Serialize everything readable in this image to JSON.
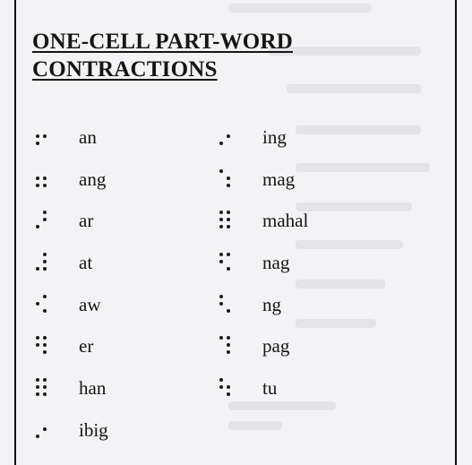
{
  "title": {
    "line1": "ONE-CELL PART-WORD",
    "line2": "CONTRACTIONS"
  },
  "contractions_left": [
    {
      "braille": "⠖",
      "dots": [
        2,
        3,
        5
      ],
      "word": "an"
    },
    {
      "braille": "⠶",
      "dots": [
        2,
        3,
        5,
        6
      ],
      "word": "ang"
    },
    {
      "braille": "⠜",
      "dots": [
        3,
        4,
        5
      ],
      "word": "ar"
    },
    {
      "braille": "⠼",
      "dots": [
        3,
        4,
        5,
        6
      ],
      "word": "at"
    },
    {
      "braille": "⠪",
      "dots": [
        2,
        4,
        6
      ],
      "word": "aw"
    },
    {
      "braille": "⠻",
      "dots": [
        1,
        2,
        4,
        5,
        6
      ],
      "word": "er"
    },
    {
      "braille": "⠿",
      "dots": [
        1,
        2,
        3,
        4,
        5,
        6
      ],
      "word": "han"
    },
    {
      "braille": "⠔",
      "dots": [
        3,
        5
      ],
      "word": "ibig"
    }
  ],
  "contractions_right": [
    {
      "braille": "⠔",
      "dots": [
        3,
        5
      ],
      "word": "ing"
    },
    {
      "braille": "⠱",
      "dots": [
        1,
        5,
        6
      ],
      "word": "mag"
    },
    {
      "braille": "⠿",
      "dots": [
        1,
        2,
        3,
        4,
        5,
        6
      ],
      "word": "mahal"
    },
    {
      "braille": "⠫",
      "dots": [
        1,
        2,
        4,
        6
      ],
      "word": "nag"
    },
    {
      "braille": "⠣",
      "dots": [
        1,
        2,
        6
      ],
      "word": "ng"
    },
    {
      "braille": "⠹",
      "dots": [
        1,
        4,
        5,
        6
      ],
      "word": "pag"
    },
    {
      "braille": "⠳",
      "dots": [
        1,
        2,
        5,
        6
      ],
      "word": "tu"
    }
  ]
}
